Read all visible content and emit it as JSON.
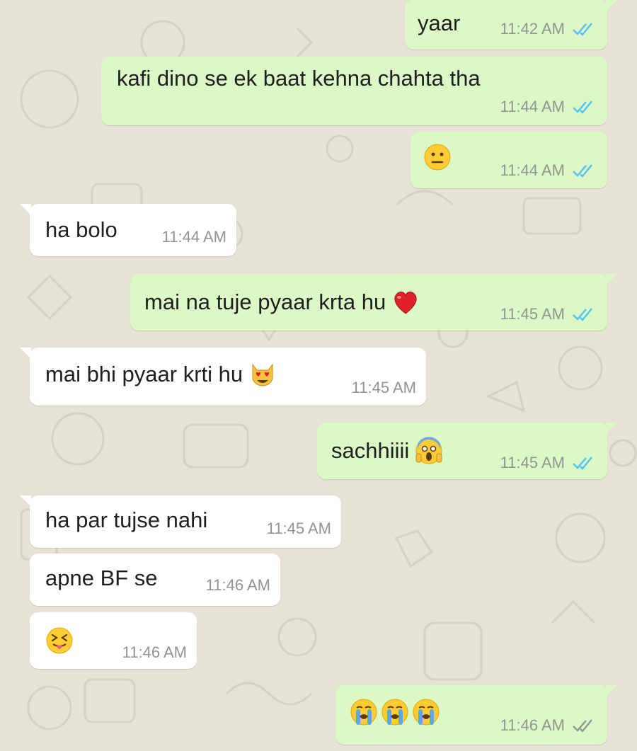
{
  "colors": {
    "outgoing_bubble": "#dcf8c6",
    "incoming_bubble": "#ffffff",
    "wallpaper": "#e7e2d6",
    "read_ticks": "#4fc3f7",
    "delivered_ticks": "#8f9692"
  },
  "messages": [
    {
      "direction": "out",
      "text": "yaar",
      "time": "11:42 AM",
      "ticks": "read-ticks-icon"
    },
    {
      "direction": "out",
      "text": "kafi dino se ek baat kehna chahta tha",
      "time": "11:44 AM",
      "ticks": "read-ticks-icon"
    },
    {
      "direction": "out",
      "text": "",
      "emoji": [
        "neutral-face-emoji"
      ],
      "time": "11:44 AM",
      "ticks": "read-ticks-icon"
    },
    {
      "direction": "in",
      "text": "ha bolo",
      "time": "11:44 AM"
    },
    {
      "direction": "out",
      "text": "mai na tuje pyaar krta hu",
      "emoji": [
        "red-heart-emoji"
      ],
      "time": "11:45 AM",
      "ticks": "read-ticks-icon"
    },
    {
      "direction": "in",
      "text": "mai bhi pyaar krti hu",
      "emoji": [
        "heart-eyes-cat-emoji"
      ],
      "time": "11:45 AM"
    },
    {
      "direction": "out",
      "text": "sachhiiii",
      "emoji": [
        "screaming-face-emoji"
      ],
      "time": "11:45 AM",
      "ticks": "read-ticks-icon"
    },
    {
      "direction": "in",
      "text": "ha par tujse nahi",
      "time": "11:45 AM"
    },
    {
      "direction": "in",
      "text": "apne BF se",
      "time": "11:46 AM"
    },
    {
      "direction": "in",
      "text": "",
      "emoji": [
        "squinting-tongue-emoji"
      ],
      "time": "11:46 AM"
    },
    {
      "direction": "out",
      "text": "",
      "emoji": [
        "loudly-crying-emoji",
        "loudly-crying-emoji",
        "loudly-crying-emoji"
      ],
      "time": "11:46 AM",
      "ticks": "delivered-ticks-icon"
    }
  ]
}
